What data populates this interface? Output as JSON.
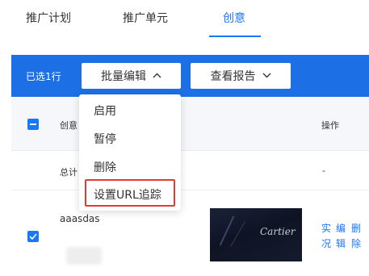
{
  "tabs": [
    "推广计划",
    "推广单元",
    "创意"
  ],
  "toolbar": {
    "selected_text": "已选1行",
    "bulk_edit_label": "批量编辑",
    "view_report_label": "查看报告"
  },
  "table": {
    "header": {
      "creative_label": "创意",
      "operation_label": "操作"
    },
    "total_row": {
      "label": "总计",
      "operation_value": "-"
    },
    "rows": [
      {
        "name": "aaasdas",
        "thumbnail_text": "Cartier",
        "operations": [
          "实况",
          "编辑",
          "删除"
        ]
      }
    ]
  },
  "dropdown": {
    "items": [
      "启用",
      "暂停",
      "删除",
      "设置URL追踪"
    ]
  },
  "colors": {
    "accent": "#1677ff",
    "toolbar_bg": "#1d6fe6",
    "highlight": "#e53935"
  }
}
